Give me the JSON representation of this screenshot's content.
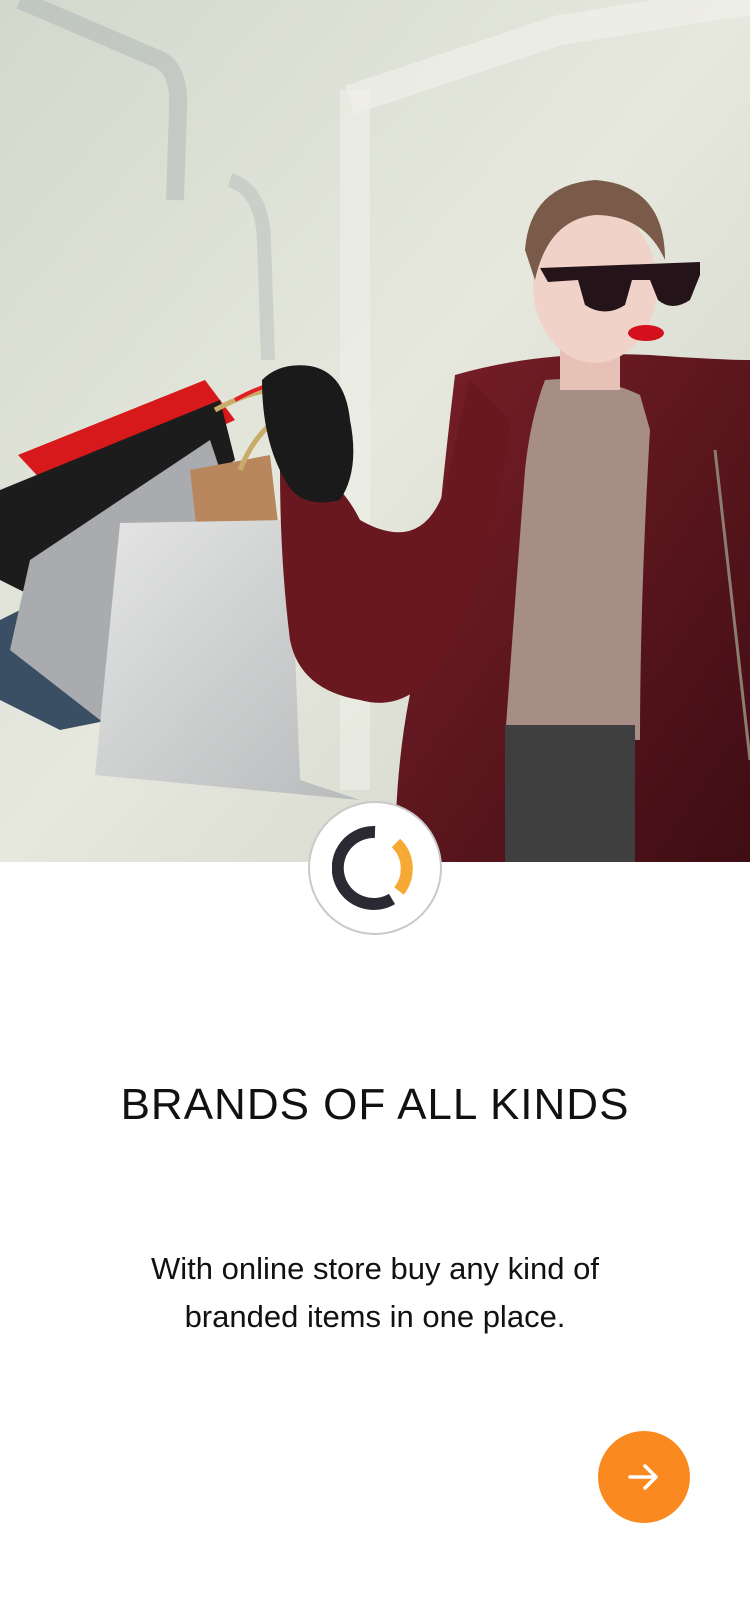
{
  "onboarding": {
    "title": "BRANDS OF ALL KINDS",
    "description": "With online store buy any kind of branded items in one place."
  },
  "icons": {
    "logo": "ring-logo-icon",
    "next": "arrow-right-icon"
  },
  "colors": {
    "accent": "#fa8a1f",
    "logo_dark": "#2b2a33",
    "logo_accent": "#f6a935",
    "text": "#111111",
    "coat": "#6e1b22"
  }
}
